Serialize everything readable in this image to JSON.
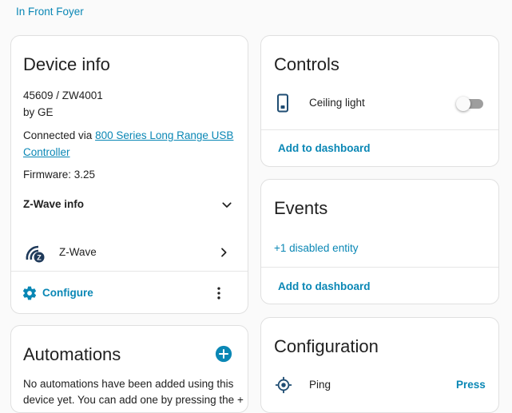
{
  "breadcrumb": {
    "area": "In Front Foyer"
  },
  "device_info": {
    "title": "Device info",
    "model": "45609 / ZW4001",
    "manufacturer": "by GE",
    "connected_prefix": "Connected via ",
    "controller_line1": "800 Series Long Range USB",
    "controller_line2": "Controller",
    "firmware": "Firmware: 3.25",
    "zwave_info_label": "Z-Wave info",
    "integration_label": "Z-Wave",
    "configure_label": "Configure"
  },
  "automations": {
    "title": "Automations",
    "empty_line1": "No automations have been added using this",
    "empty_line2": "device yet. You can add one by pressing the +"
  },
  "controls": {
    "title": "Controls",
    "entity_label": "Ceiling light",
    "entity_state": "off",
    "add_label": "Add to dashboard"
  },
  "events": {
    "title": "Events",
    "disabled_label": "+1 disabled entity",
    "add_label": "Add to dashboard"
  },
  "configuration": {
    "title": "Configuration",
    "ping_label": "Ping",
    "press_label": "Press"
  },
  "colors": {
    "accent": "#0a87b5",
    "card_border": "#e0e0e0",
    "toggle_off": "#9e9e9e"
  },
  "icons": {
    "controls_entity": "light-switch-icon",
    "zwave": "zwave-icon",
    "configure": "gear-icon",
    "more": "dots-vertical-icon",
    "add_automation": "plus-circle-icon",
    "ping": "crosshairs-gps-icon",
    "expand": "chevron-down-icon",
    "navigate": "chevron-right-icon"
  }
}
